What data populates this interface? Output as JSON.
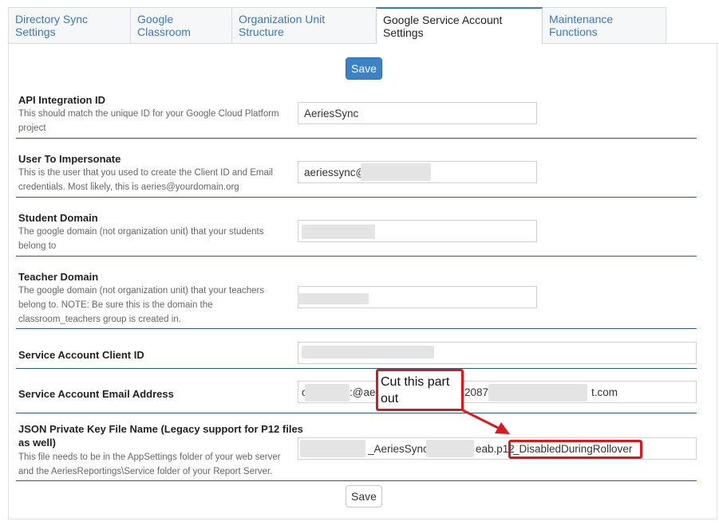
{
  "tabs": [
    {
      "label": "Directory Sync Settings"
    },
    {
      "label": "Google Classroom"
    },
    {
      "label": "Organization Unit Structure"
    },
    {
      "label": "Google Service Account Settings"
    },
    {
      "label": "Maintenance Functions"
    }
  ],
  "active_tab": 3,
  "buttons": {
    "save_top": "Save",
    "save_bottom": "Save"
  },
  "fields": {
    "api_integration_id": {
      "label": "API Integration ID",
      "desc": "This should match the unique ID for your Google Cloud Platform project",
      "value": "AeriesSync"
    },
    "user_to_impersonate": {
      "label": "User To Impersonate",
      "desc": "This is the user that you used to create the Client ID and Email credentials. Most likely, this is aeries@yourdomain.org",
      "value": "aeriessync@"
    },
    "student_domain": {
      "label": "Student Domain",
      "desc": "The google domain (not organization unit) that your students belong to",
      "value": ""
    },
    "teacher_domain": {
      "label": "Teacher Domain",
      "desc": "The google domain (not organization unit) that your teachers belong to. NOTE: Be sure this is the domain the classroom_teachers group is created in.",
      "value": ""
    },
    "client_id": {
      "label": "Service Account Client ID",
      "value": ""
    },
    "email_address": {
      "label": "Service Account Email Address",
      "value_a": "c",
      "value_b": ":@ae",
      "value_c": "20873",
      "value_d": "t.com"
    },
    "json_key": {
      "label": "JSON Private Key File Name (Legacy support for P12 files as well)",
      "desc": "This file needs to be in the AppSettings folder of your web server and the AeriesReportings\\Service folder of your Report Server.",
      "value_a": "_AeriesSync-",
      "value_b": "eab.p12",
      "value_c": "_DisabledDuringRollover"
    }
  },
  "annotation": {
    "callout_text": "Cut this part out",
    "color": "#d71920"
  }
}
